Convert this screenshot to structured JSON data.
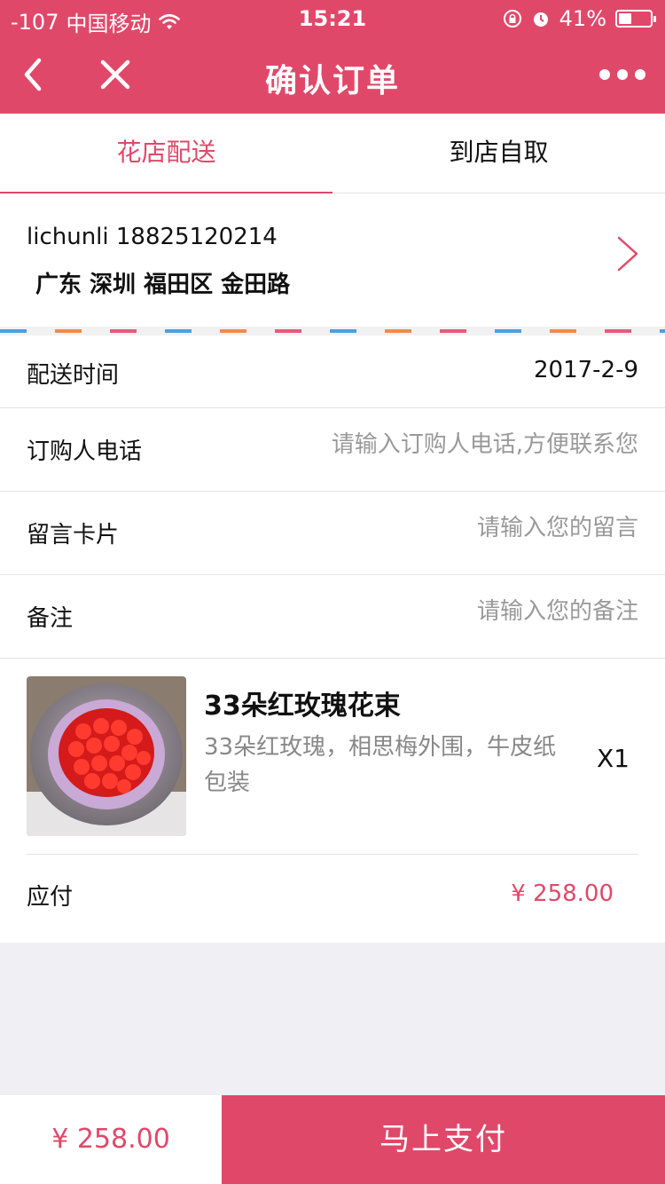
{
  "status_bar": {
    "signal": "-107",
    "carrier": "中国移动",
    "time": "15:21",
    "battery_text": "41%",
    "battery_level": 0.41
  },
  "nav": {
    "title": "确认订单"
  },
  "tabs": [
    {
      "label": "花店配送",
      "active": true
    },
    {
      "label": "到店自取",
      "active": false
    }
  ],
  "address": {
    "name_phone": "lichunli 18825120214",
    "line": "广东 深圳 福田区 金田路"
  },
  "form": {
    "delivery_time_label": "配送时间",
    "delivery_time_value": "2017-2-9",
    "phone_label": "订购人电话",
    "phone_placeholder": "请输入订购人电话,方便联系您",
    "card_label": "留言卡片",
    "card_placeholder": "请输入您的留言",
    "remark_label": "备注",
    "remark_placeholder": "请输入您的备注"
  },
  "product": {
    "title": "33朵红玫瑰花束",
    "desc": "33朵红玫瑰，相思梅外围，牛皮纸包装",
    "qty": "X1",
    "pay_label": "应付",
    "pay_amount": "¥ 258.00"
  },
  "bottom": {
    "total": "¥ 258.00",
    "pay_button": "马上支付"
  },
  "colors": {
    "accent": "#e0486a",
    "background": "#efeff4"
  }
}
